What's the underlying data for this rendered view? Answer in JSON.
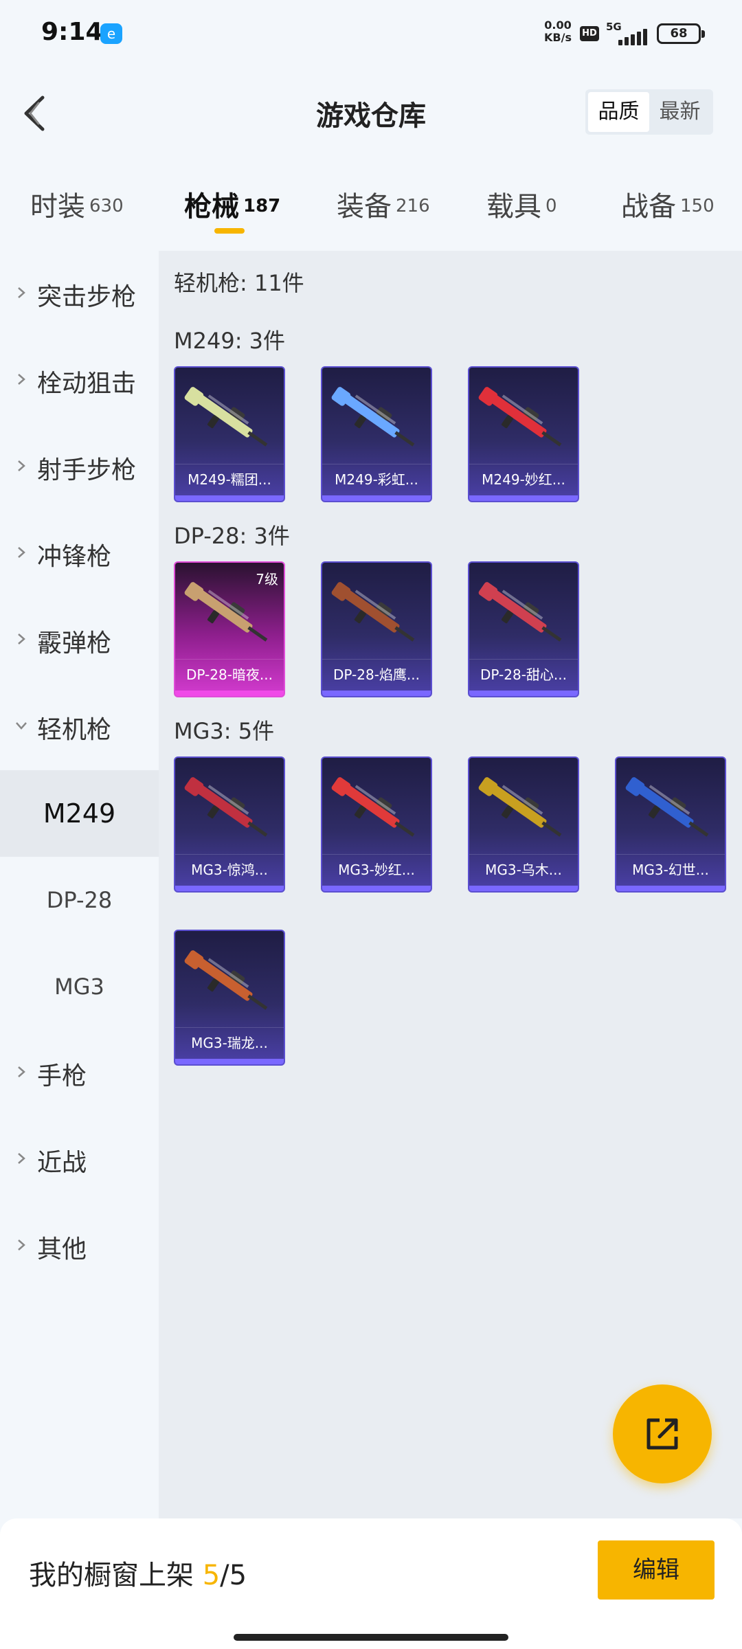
{
  "status_bar": {
    "time": "9:14",
    "app_badge_icon": "e-app-icon",
    "net_speed_value": "0.00",
    "net_speed_unit": "KB/s",
    "hd": "HD",
    "network": "5G",
    "battery": "68"
  },
  "header": {
    "back_icon": "chevron-left-icon",
    "title": "游戏仓库",
    "sort_options": [
      "品质",
      "最新"
    ],
    "sort_selected": "品质"
  },
  "tabs": [
    {
      "label": "时装",
      "count": "630"
    },
    {
      "label": "枪械",
      "count": "187",
      "active": true
    },
    {
      "label": "装备",
      "count": "216"
    },
    {
      "label": "载具",
      "count": "0"
    },
    {
      "label": "战备",
      "count": "150"
    }
  ],
  "sidebar": {
    "categories": [
      {
        "label": "突击步枪"
      },
      {
        "label": "栓动狙击"
      },
      {
        "label": "射手步枪"
      },
      {
        "label": "冲锋枪"
      },
      {
        "label": "霰弹枪"
      },
      {
        "label": "轻机枪",
        "expanded": true
      }
    ],
    "sub_items": [
      {
        "label": "M249",
        "active": true
      },
      {
        "label": "DP-28"
      },
      {
        "label": "MG3"
      }
    ],
    "more_categories": [
      {
        "label": "手枪"
      },
      {
        "label": "近战"
      },
      {
        "label": "其他"
      }
    ]
  },
  "content": {
    "summary": "轻机枪: 11件",
    "groups": [
      {
        "title": "M249: 3件",
        "items": [
          {
            "name": "M249-糯团...",
            "color": "#d8e0a0"
          },
          {
            "name": "M249-彩虹...",
            "color": "#6aa8ff"
          },
          {
            "name": "M249-妙红...",
            "color": "#e0303a"
          }
        ]
      },
      {
        "title": "DP-28: 3件",
        "items": [
          {
            "name": "DP-28-暗夜...",
            "level": "7级",
            "quality": "pink",
            "color": "#c8a070"
          },
          {
            "name": "DP-28-焰鹰...",
            "color": "#a05030"
          },
          {
            "name": "DP-28-甜心...",
            "color": "#d04050"
          }
        ]
      },
      {
        "title": "MG3: 5件",
        "items": [
          {
            "name": "MG3-惊鸿...",
            "color": "#c03040"
          },
          {
            "name": "MG3-妙红...",
            "color": "#e03a3a"
          },
          {
            "name": "MG3-乌木...",
            "color": "#c8a020"
          },
          {
            "name": "MG3-幻世...",
            "color": "#3060d0"
          },
          {
            "name": "MG3-瑞龙...",
            "color": "#c86030"
          }
        ]
      }
    ]
  },
  "fab": {
    "icon": "share-external-icon"
  },
  "bottom_bar": {
    "showcase_prefix": "我的橱窗上架",
    "current": "5",
    "total": "/5",
    "edit_label": "编辑"
  },
  "colors": {
    "accent": "#f7b500",
    "card_purple": "#5b4fd0",
    "card_pink": "#e04cd8"
  }
}
